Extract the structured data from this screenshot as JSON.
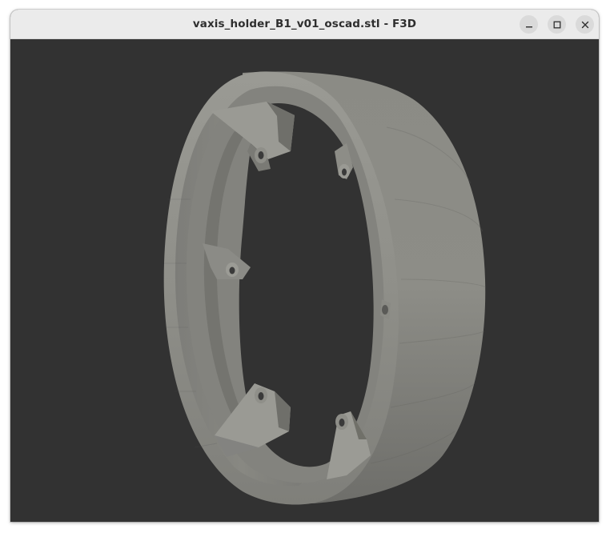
{
  "window": {
    "title": "vaxis_holder_B1_v01_oscad.stl - F3D",
    "background_color": "#323232",
    "titlebar_color": "#ebebeb"
  },
  "controls": {
    "minimize_icon": "minimize-icon",
    "maximize_icon": "maximize-icon",
    "close_icon": "close-icon"
  },
  "viewport": {
    "model": "3d-ring-holder",
    "model_color": "#8c8c86"
  }
}
